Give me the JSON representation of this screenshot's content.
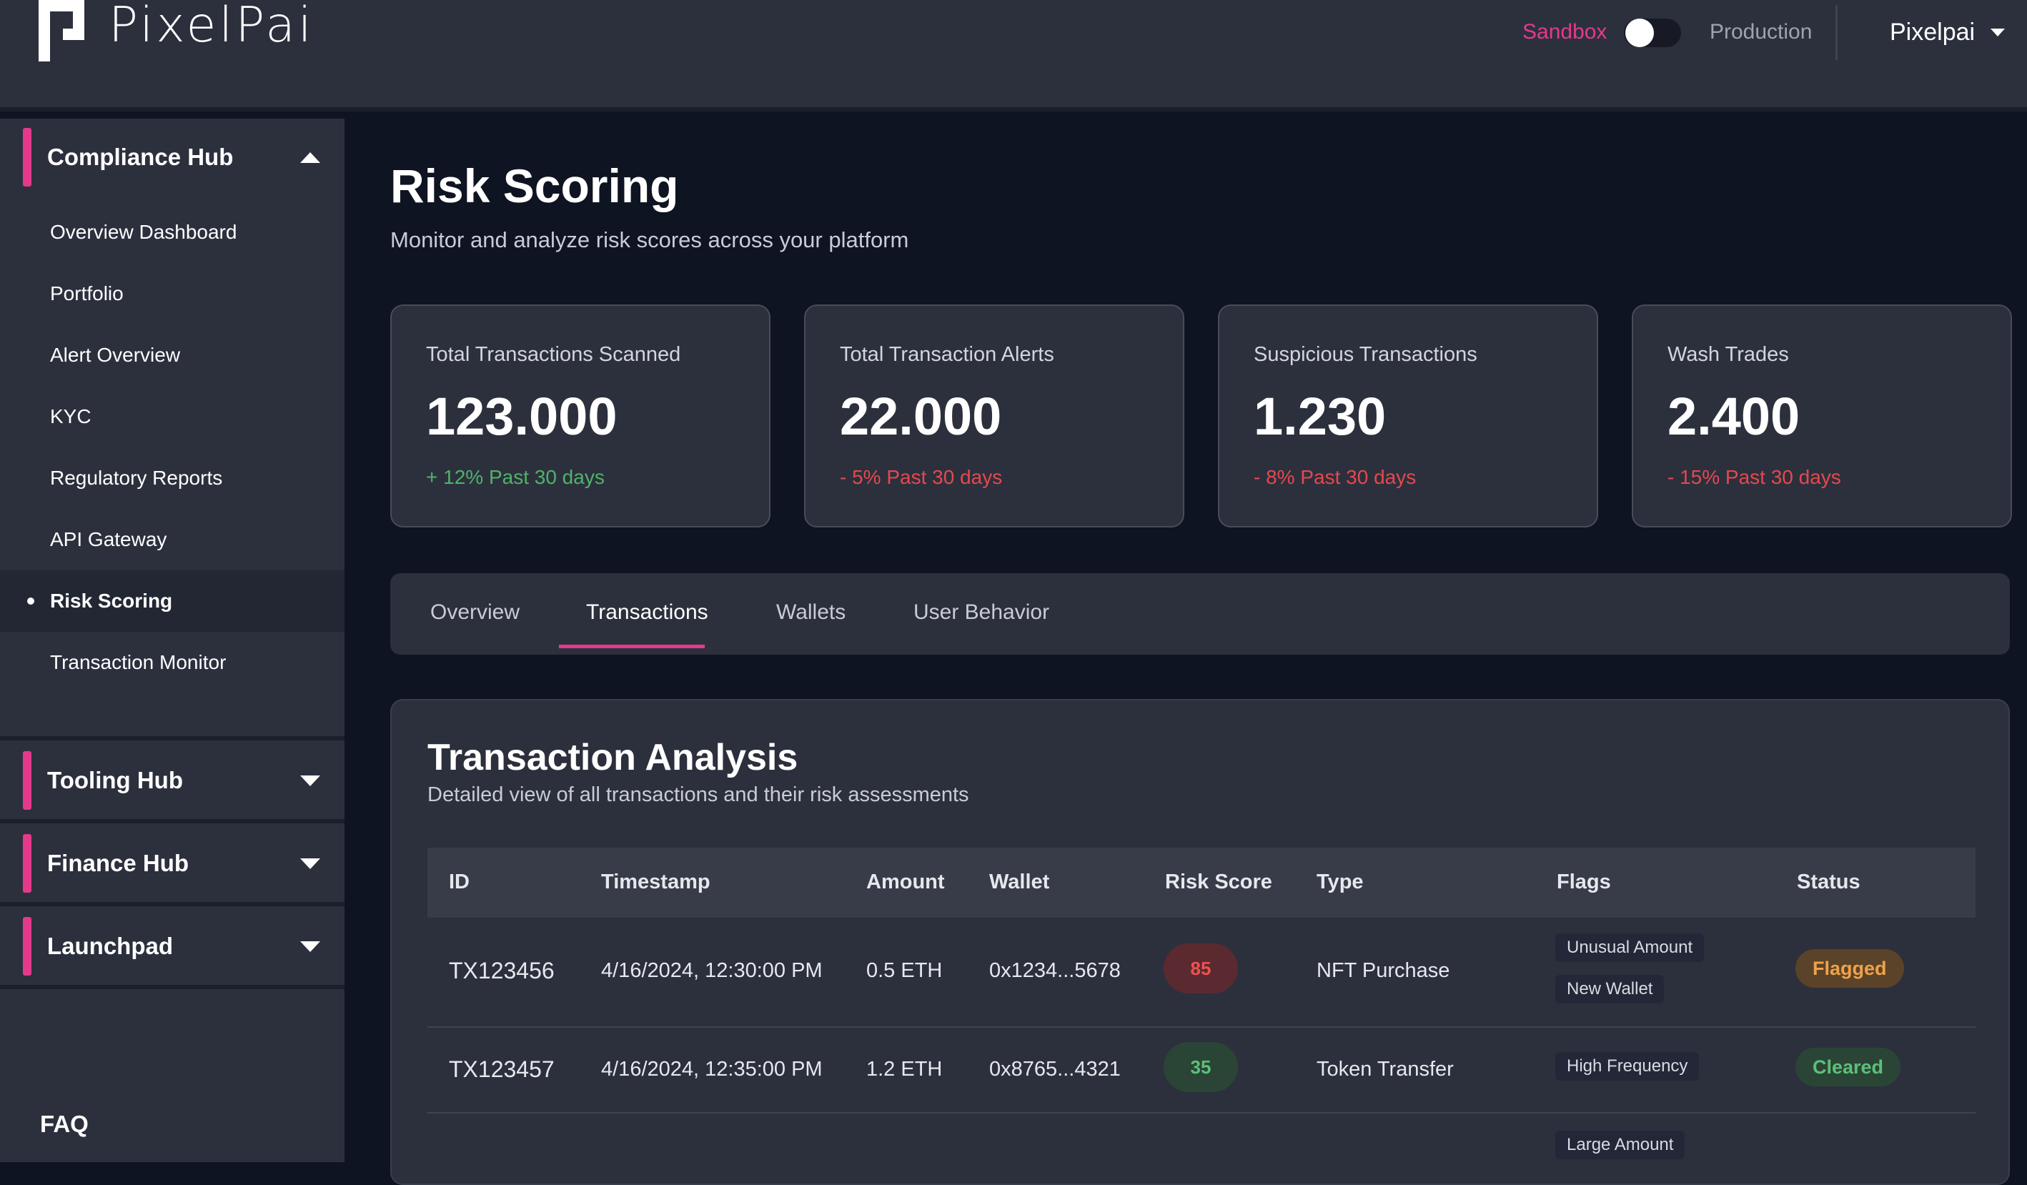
{
  "header": {
    "logo_text": "PixelPai",
    "env_sandbox": "Sandbox",
    "env_production": "Production",
    "user_name": "Pixelpai"
  },
  "sidebar": {
    "hubs": [
      {
        "label": "Compliance Hub",
        "expanded": true
      },
      {
        "label": "Tooling Hub",
        "expanded": false
      },
      {
        "label": "Finance Hub",
        "expanded": false
      },
      {
        "label": "Launchpad",
        "expanded": false
      }
    ],
    "items": [
      {
        "label": "Overview Dashboard"
      },
      {
        "label": "Portfolio"
      },
      {
        "label": "Alert Overview"
      },
      {
        "label": "KYC"
      },
      {
        "label": "Regulatory Reports"
      },
      {
        "label": "API Gateway"
      },
      {
        "label": "Risk Scoring",
        "active": true
      },
      {
        "label": "Transaction Monitor"
      }
    ],
    "faq": "FAQ"
  },
  "page": {
    "title": "Risk Scoring",
    "subtitle": "Monitor and analyze risk scores across your platform"
  },
  "stats": [
    {
      "label": "Total Transactions Scanned",
      "value": "123.000",
      "change": "+ 12% Past 30 days"
    },
    {
      "label": "Total Transaction Alerts",
      "value": "22.000",
      "change": "- 5% Past 30 days"
    },
    {
      "label": "Suspicious Transactions",
      "value": "1.230",
      "change": "- 8% Past 30 days"
    },
    {
      "label": "Wash Trades",
      "value": "2.400",
      "change": "- 15% Past 30 days"
    }
  ],
  "tabs": [
    {
      "label": "Overview"
    },
    {
      "label": "Transactions",
      "active": true
    },
    {
      "label": "Wallets"
    },
    {
      "label": "User Behavior"
    }
  ],
  "analysis": {
    "title": "Transaction Analysis",
    "subtitle": "Detailed view of all transactions and their risk assessments",
    "columns": [
      "ID",
      "Timestamp",
      "Amount",
      "Wallet",
      "Risk Score",
      "Type",
      "Flags",
      "Status"
    ],
    "rows": [
      {
        "id": "TX123456",
        "timestamp": "4/16/2024, 12:30:00 PM",
        "amount": "0.5 ETH",
        "wallet": "0x1234...5678",
        "risk_score": "85",
        "type": "NFT Purchase",
        "flags": [
          "Unusual Amount",
          "New Wallet"
        ],
        "status": "Flagged"
      },
      {
        "id": "TX123457",
        "timestamp": "4/16/2024, 12:35:00 PM",
        "amount": "1.2 ETH",
        "wallet": "0x8765...4321",
        "risk_score": "35",
        "type": "Token Transfer",
        "flags": [
          "High Frequency"
        ],
        "status": "Cleared"
      },
      {
        "flags": [
          "Large Amount"
        ]
      }
    ]
  },
  "colors": {
    "accent": "#e5398c",
    "positive": "#4fb368",
    "negative": "#e5484d",
    "warning": "#f0a24a"
  }
}
